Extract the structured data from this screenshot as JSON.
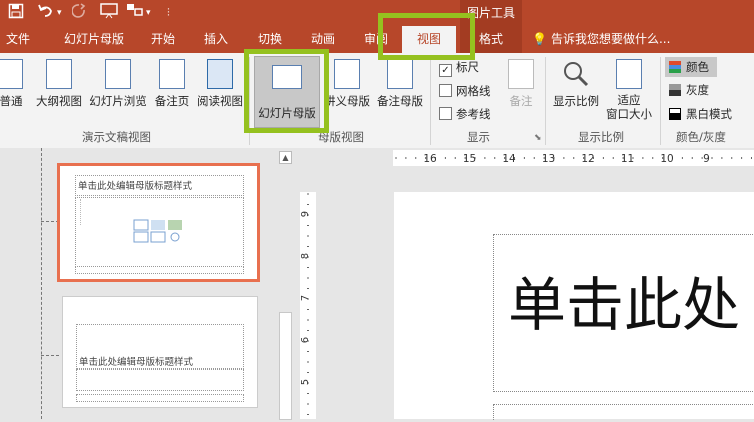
{
  "titlebar": {
    "context_label": "图片工具",
    "save_icon": "save-icon",
    "undo_icon": "undo-icon",
    "redo_icon": "redo-icon",
    "bg_color": "#b7472a"
  },
  "tabs": [
    {
      "label": "文件"
    },
    {
      "label": "幻灯片母版"
    },
    {
      "label": "开始"
    },
    {
      "label": "插入"
    },
    {
      "label": "切换"
    },
    {
      "label": "动画"
    },
    {
      "label": "审阅"
    },
    {
      "label": "视图",
      "active": true
    },
    {
      "label": "格式"
    }
  ],
  "tell_me": "告诉我您想要做什么...",
  "ribbon": {
    "buttons": {
      "normal": "普通",
      "outline": "大纲视图",
      "slide_sorter": "幻灯片浏览",
      "notes_page": "备注页",
      "reading_view": "阅读视图",
      "slide_master": "幻灯片母版",
      "handout_master": "讲义母版",
      "notes_master": "备注母版",
      "notes": "备注",
      "zoom": "显示比例",
      "fit_window_1": "适应",
      "fit_window_2": "窗口大小"
    },
    "checkboxes": {
      "ruler": "标尺",
      "gridlines": "网格线",
      "guides": "参考线"
    },
    "color_options": {
      "color": "颜色",
      "grayscale": "灰度",
      "bw": "黑白模式"
    },
    "groups": {
      "presentation_views": "演示文稿视图",
      "master_views": "母版视图",
      "show": "显示",
      "zoom": "显示比例",
      "color_grayscale": "颜色/灰度"
    }
  },
  "thumbnails": [
    {
      "title": "单击此处编辑母版标题样式",
      "selected": true
    },
    {
      "title": "单击此处编辑母版标题样式",
      "selected": false
    }
  ],
  "ruler_labels": [
    "16",
    "15",
    "14",
    "13",
    "12",
    "11",
    "10",
    "9"
  ],
  "vruler_labels": [
    "9",
    "8",
    "7",
    "6",
    "5"
  ],
  "slide": {
    "title_partial": "单击此处"
  },
  "highlight_color": "#95c11f"
}
